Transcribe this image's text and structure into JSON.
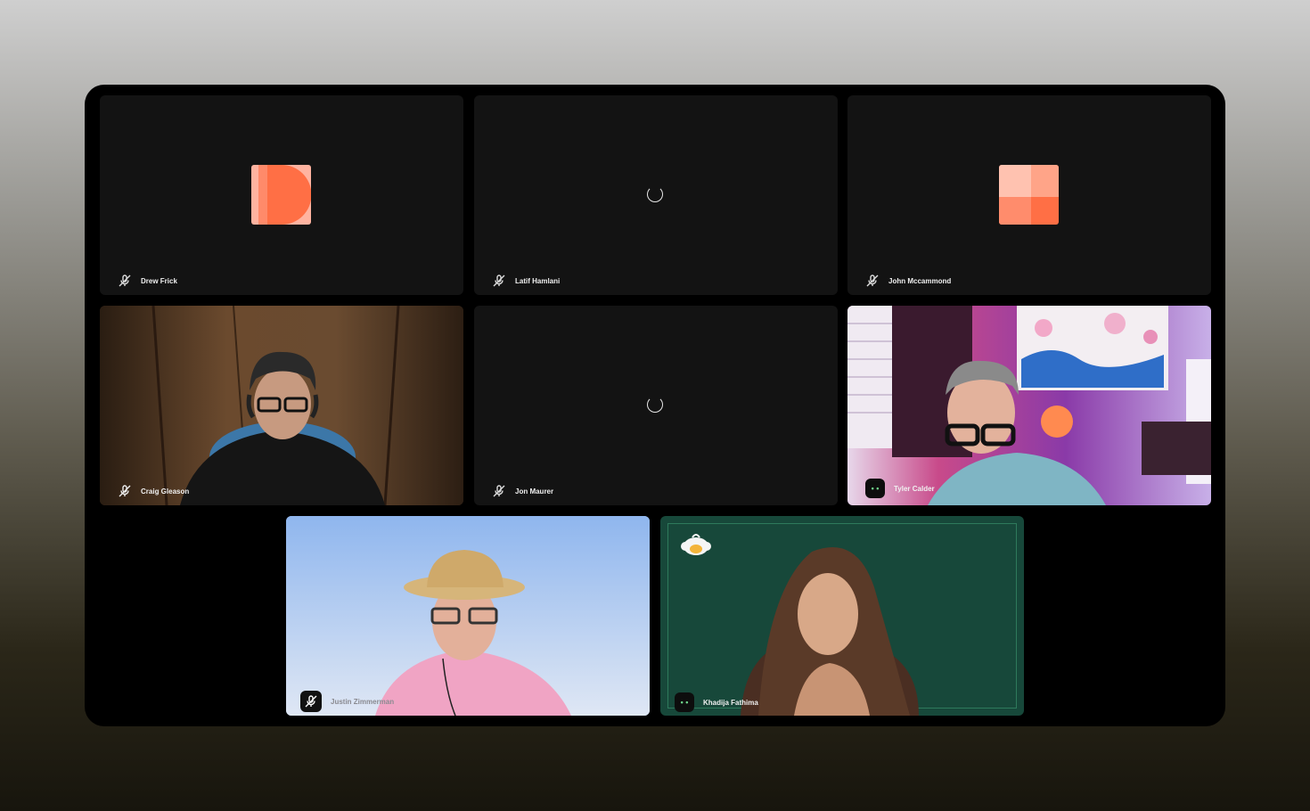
{
  "participants": [
    {
      "name": "Drew Frick"
    },
    {
      "name": "Latif Hamlani"
    },
    {
      "name": "John Mccammond"
    },
    {
      "name": "Craig Gleason"
    },
    {
      "name": "Jon Maurer"
    },
    {
      "name": "Tyler Calder"
    },
    {
      "name": "Justin Zimmerman"
    },
    {
      "name": "Khadija Fathima"
    }
  ],
  "colors": {
    "avatar_primary": "#ff7043",
    "avatar_light": "#ffab91",
    "green_bg": "#17483a"
  }
}
